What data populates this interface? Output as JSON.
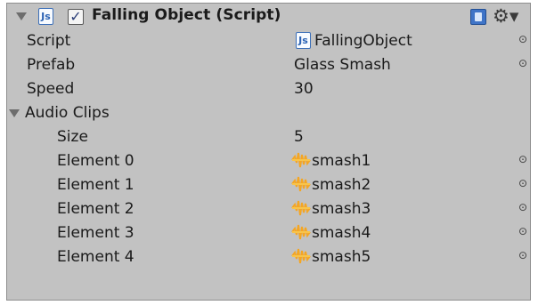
{
  "component": {
    "title": "Falling Object (Script)",
    "script_icon_label": "Js",
    "enabled_mark": "✓",
    "settings_glyph": "⚙▾"
  },
  "fields": {
    "script": {
      "label": "Script",
      "value": "FallingObject"
    },
    "prefab": {
      "label": "Prefab",
      "value": "Glass Smash"
    },
    "speed": {
      "label": "Speed",
      "value": "30"
    }
  },
  "audio_clips": {
    "label": "Audio Clips",
    "size_label": "Size",
    "size": "5",
    "elements": [
      {
        "label": "Element 0",
        "value": "smash1"
      },
      {
        "label": "Element 1",
        "value": "smash2"
      },
      {
        "label": "Element 2",
        "value": "smash3"
      },
      {
        "label": "Element 3",
        "value": "smash4"
      },
      {
        "label": "Element 4",
        "value": "smash5"
      }
    ]
  },
  "object_picker_glyph": "⊙",
  "colors": {
    "panel_background": "#c2c2c2",
    "script_icon_accent": "#2a62b4",
    "audio_icon_accent": "#f5a623"
  },
  "icons": {
    "header_fold": "triangle-down-icon",
    "script": "js-script-icon",
    "help": "book-icon",
    "settings": "gear-icon",
    "audio": "audio-clip-icon",
    "picker": "object-picker-icon"
  }
}
